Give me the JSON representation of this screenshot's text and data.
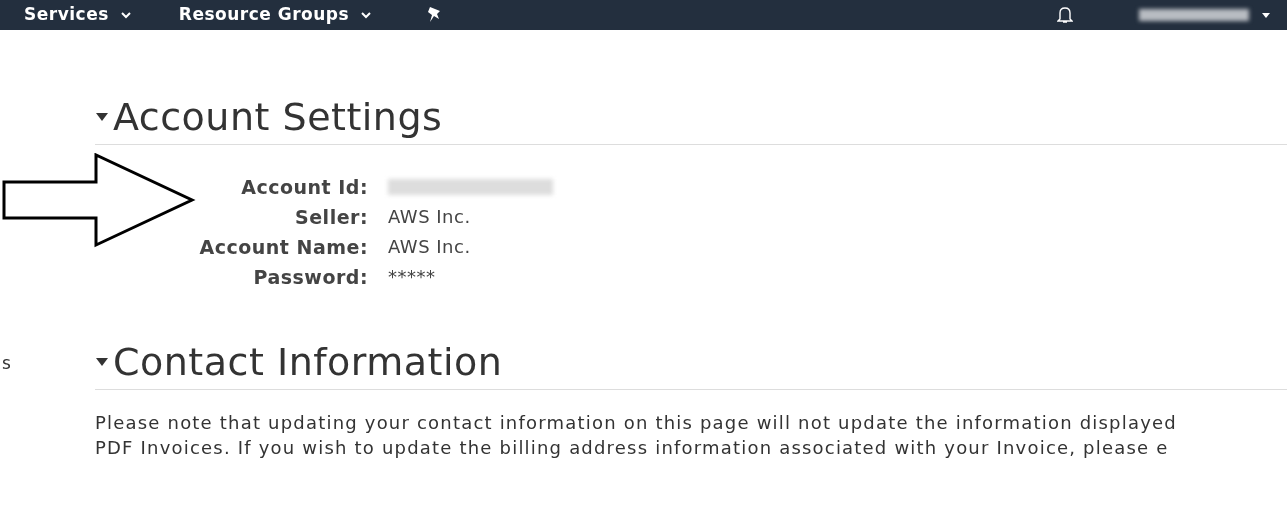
{
  "top_nav": {
    "menus": [
      {
        "label": "Services"
      },
      {
        "label": "Resource Groups"
      }
    ]
  },
  "sidebar_fragments": [
    "s"
  ],
  "sections": [
    {
      "title": "Account Settings",
      "expanded": true,
      "fields": [
        {
          "label": "Account Id:",
          "value_hidden": true
        },
        {
          "label": "Seller:",
          "value": "AWS Inc."
        },
        {
          "label": "Account Name:",
          "value": "AWS Inc."
        },
        {
          "label": "Password:",
          "value": "*****"
        }
      ]
    },
    {
      "title": "Contact Information",
      "expanded": true,
      "lines": [
        "Please note that updating your contact information on this page will not update the information displayed",
        "PDF Invoices. If you wish to update the billing address information associated with your Invoice, please e"
      ]
    }
  ]
}
